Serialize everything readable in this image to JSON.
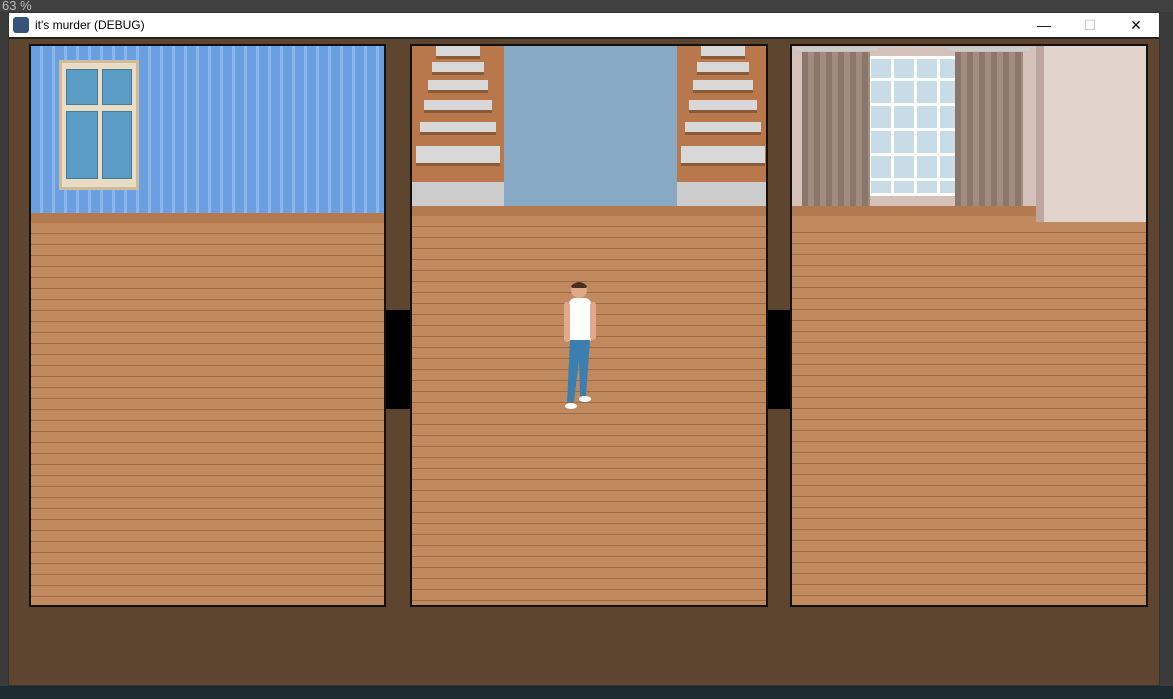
{
  "background": {
    "zoom_label": "63 %"
  },
  "window": {
    "title": "it's murder (DEBUG)",
    "icon": "godot-icon",
    "controls": {
      "minimize": "—",
      "maximize": "☐",
      "close": "✕"
    }
  },
  "scene": {
    "rooms": [
      {
        "name": "blue-wall-room",
        "wall_color": "#6aa0e0"
      },
      {
        "name": "stairs-hallway",
        "wall_color": "#87a9c4"
      },
      {
        "name": "curtain-window-room",
        "wall_color": "#d4c1b9"
      }
    ],
    "floor_color": "#c08a5e",
    "background_color": "#5e4530"
  }
}
